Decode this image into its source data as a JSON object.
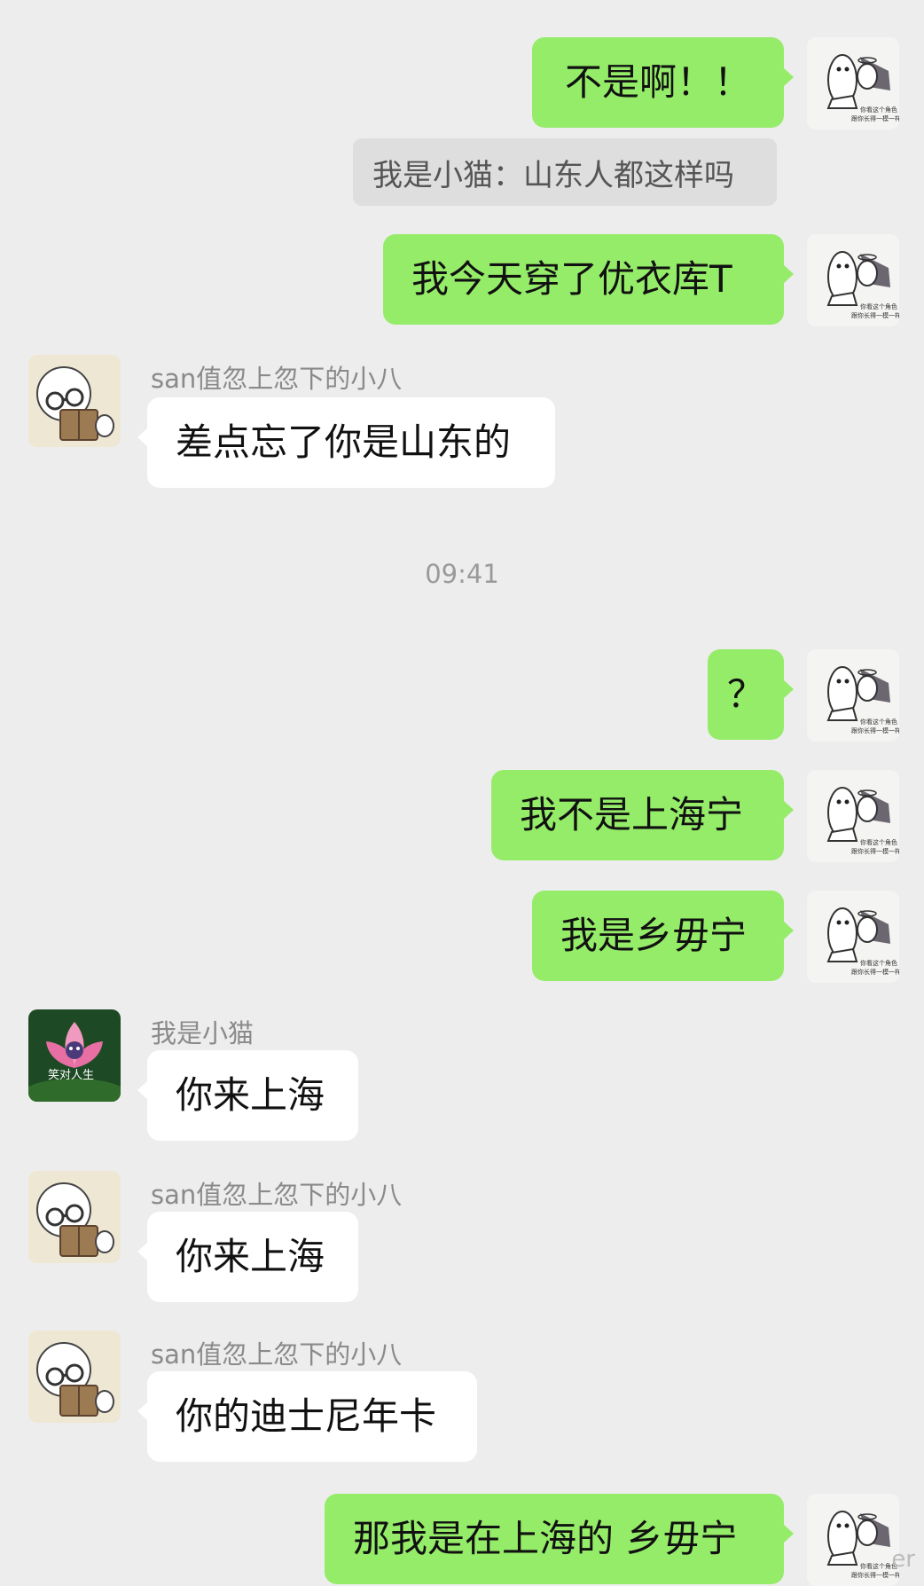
{
  "messages": [
    {
      "text": "不是啊！！"
    },
    {
      "quote": "我是小猫：山东人都这样吗"
    },
    {
      "text": "我今天穿了优衣库T"
    },
    {
      "sender": "san值忽上忽下的小八",
      "text": "差点忘了你是山东的"
    },
    {
      "timestamp": "09:41"
    },
    {
      "text": "？"
    },
    {
      "text": "我不是上海宁"
    },
    {
      "text": "我是乡毋宁"
    },
    {
      "sender": "我是小猫",
      "text": "你来上海",
      "avatar_caption": "笑对人生"
    },
    {
      "sender": "san值忽上忽下的小八",
      "text": "你来上海"
    },
    {
      "sender": "san值忽上忽下的小八",
      "text": "你的迪士尼年卡"
    },
    {
      "text": "那我是在上海的 乡毋宁"
    }
  ],
  "my_avatar": {
    "caption_line1": "你看这个角色",
    "caption_line2": "跟你长得一模一样"
  },
  "watermark": "er",
  "colors": {
    "background": "#ededed",
    "my_bubble": "#95ec69",
    "their_bubble": "#ffffff"
  },
  "icons": {
    "my_avatar": "blob-meme-avatar-icon",
    "friend_avatar": "reading-bear-avatar-icon",
    "cat_avatar": "lotus-avatar-icon"
  }
}
